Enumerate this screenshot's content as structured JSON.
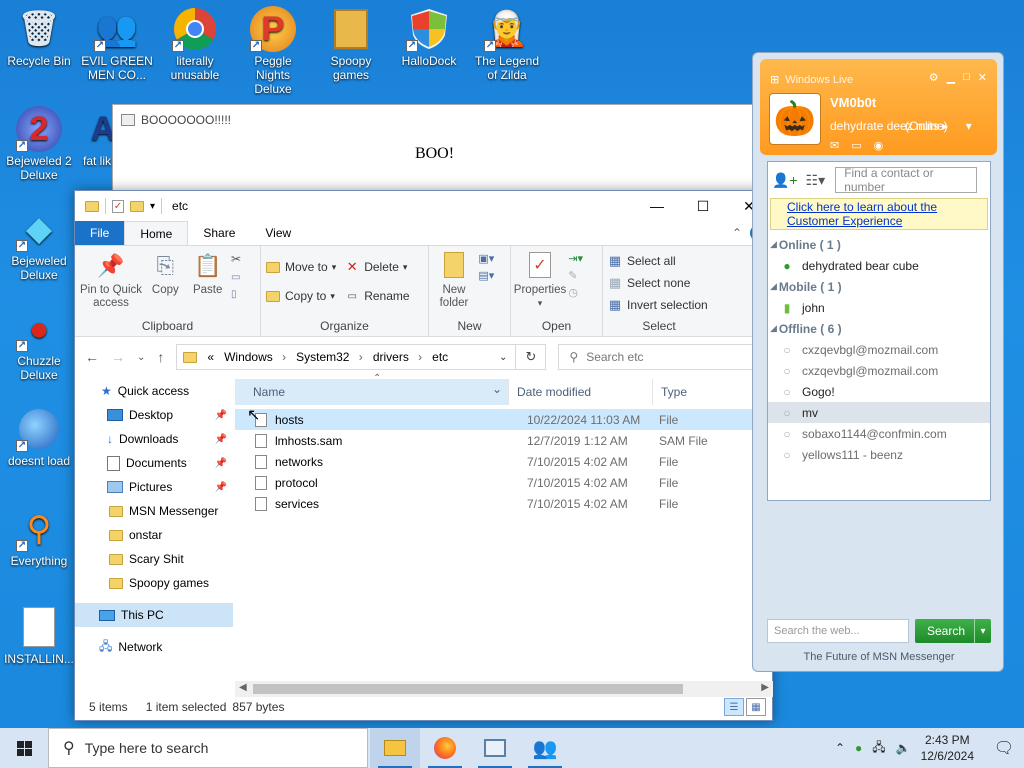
{
  "desktop": {
    "icons": [
      {
        "label": "Recycle Bin",
        "glyph": "🗑"
      },
      {
        "label": "EVIL GREEN MEN CO...",
        "glyph": "👥"
      },
      {
        "label": "literally unusable",
        "glyph": "◉"
      },
      {
        "label": "Peggle Nights Deluxe",
        "glyph": "P"
      },
      {
        "label": "Spoopy games",
        "glyph": "📁"
      },
      {
        "label": "HalloDock",
        "glyph": "⛨"
      },
      {
        "label": "The Legend of Zilda",
        "glyph": "🧝"
      },
      {
        "label": "Bejeweled 2 Deluxe",
        "glyph": "2"
      },
      {
        "label": "fat lik",
        "glyph": "A"
      },
      {
        "label": "Bejeweled Deluxe",
        "glyph": "◆"
      },
      {
        "label": "Chuzzle Deluxe",
        "glyph": "●"
      },
      {
        "label": "doesnt load",
        "glyph": "◎"
      },
      {
        "label": "Everything",
        "glyph": "⚲"
      },
      {
        "label": "INSTALLIN...",
        "glyph": "📄"
      }
    ]
  },
  "boo_window": {
    "title": "BOOOOOOO!!!!!",
    "message": "BOO!"
  },
  "explorer": {
    "title": "etc",
    "window_controls": {
      "minimize": "—",
      "maximize": "☐",
      "close": "✕"
    },
    "tabs": [
      "File",
      "Home",
      "Share",
      "View"
    ],
    "ribbon": {
      "clipboard": {
        "pin": "Pin to Quick access",
        "copy": "Copy",
        "paste": "Paste",
        "group": "Clipboard"
      },
      "organize": {
        "move_to": "Move to",
        "copy_to": "Copy to",
        "delete": "Delete",
        "rename": "Rename",
        "group": "Organize"
      },
      "new": {
        "new_folder": "New folder",
        "group": "New"
      },
      "open": {
        "properties": "Properties",
        "group": "Open"
      },
      "select": {
        "select_all": "Select all",
        "select_none": "Select none",
        "invert": "Invert selection",
        "group": "Select"
      }
    },
    "address": {
      "prefix": "«",
      "path": [
        "Windows",
        "System32",
        "drivers",
        "etc"
      ]
    },
    "search_placeholder": "Search etc",
    "nav": {
      "quick_access": "Quick access",
      "items": [
        {
          "label": "Desktop",
          "pinned": true
        },
        {
          "label": "Downloads",
          "pinned": true
        },
        {
          "label": "Documents",
          "pinned": true
        },
        {
          "label": "Pictures",
          "pinned": true
        },
        {
          "label": "MSN Messenger",
          "pinned": false
        },
        {
          "label": "onstar",
          "pinned": false
        },
        {
          "label": "Scary Shit",
          "pinned": false
        },
        {
          "label": "Spoopy games",
          "pinned": false
        }
      ],
      "this_pc": "This PC",
      "network": "Network"
    },
    "columns": {
      "name": "Name",
      "date": "Date modified",
      "type": "Type"
    },
    "files": [
      {
        "name": "hosts",
        "date": "10/22/2024 11:03 AM",
        "type": "File",
        "selected": true
      },
      {
        "name": "lmhosts.sam",
        "date": "12/7/2019 1:12 AM",
        "type": "SAM File",
        "selected": false
      },
      {
        "name": "networks",
        "date": "7/10/2015 4:02 AM",
        "type": "File",
        "selected": false
      },
      {
        "name": "protocol",
        "date": "7/10/2015 4:02 AM",
        "type": "File",
        "selected": false
      },
      {
        "name": "services",
        "date": "7/10/2015 4:02 AM",
        "type": "File",
        "selected": false
      }
    ],
    "status": {
      "count": "5 items",
      "selection": "1 item selected",
      "size": "857 bytes"
    }
  },
  "msn": {
    "brand": "Windows Live",
    "user": {
      "name": "VM0b0t",
      "status": "(Online)",
      "psm": "dehydrate deez nuts"
    },
    "find_placeholder": "Find a contact or number",
    "ad": "Click here to learn about the Customer Experience",
    "groups": [
      {
        "label": "Online ( 1 )",
        "contacts": [
          {
            "name": "dehydrated bear cube",
            "state": "online"
          }
        ]
      },
      {
        "label": "Mobile ( 1 )",
        "contacts": [
          {
            "name": "john",
            "state": "mobile"
          }
        ]
      },
      {
        "label": "Offline ( 6 )",
        "contacts": [
          {
            "name": "cxzqevbgl@mozmail.com",
            "state": "offline"
          },
          {
            "name": "cxzqevbgl@mozmail.com",
            "state": "offline"
          },
          {
            "name": "Gogo!",
            "state": "offline"
          },
          {
            "name": "mv",
            "state": "offline",
            "selected": true
          },
          {
            "name": "sobaxo1144@confmin.com",
            "state": "offline"
          },
          {
            "name": "yellows111 - beenz",
            "state": "offline"
          }
        ]
      }
    ],
    "web_search_placeholder": "Search the web...",
    "search_button": "Search",
    "footer": "The Future of MSN Messenger"
  },
  "taskbar": {
    "search_placeholder": "Type here to search",
    "time": "2:43 PM",
    "date": "12/6/2024"
  },
  "colors": {
    "accent": "#1a73c8",
    "msn_orange": "#ff9a1f",
    "desktop": "#1f8fe4",
    "selection": "#cce8ff"
  }
}
